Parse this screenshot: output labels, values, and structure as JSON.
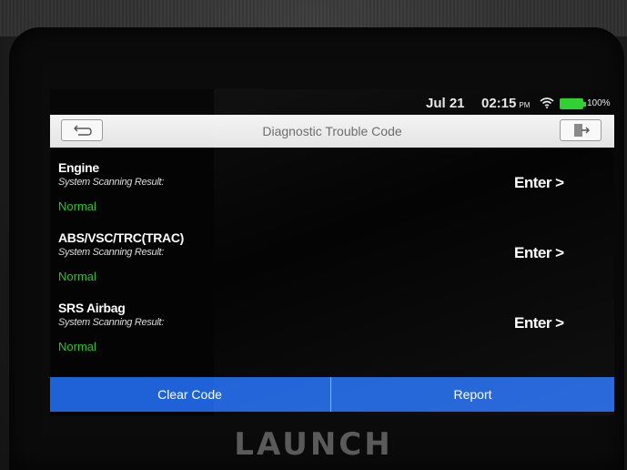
{
  "status_bar": {
    "date": "Jul 21",
    "time": "02:15",
    "ampm": "PM",
    "battery": "100%",
    "battery_color": "#2ed12e"
  },
  "title_bar": {
    "title": "Diagnostic Trouble Code",
    "back_icon": "back-arrow-icon",
    "exit_icon": "exit-icon"
  },
  "systems": [
    {
      "name": "Engine",
      "result_label": "System Scanning Result:",
      "status": "Normal",
      "enter_label": "Enter >"
    },
    {
      "name": "ABS/VSC/TRC(TRAC)",
      "result_label": "System Scanning Result:",
      "status": "Normal",
      "enter_label": "Enter >"
    },
    {
      "name": "SRS Airbag",
      "result_label": "System Scanning Result:",
      "status": "Normal",
      "enter_label": "Enter >"
    }
  ],
  "buttons": {
    "clear_code": "Clear Code",
    "report": "Report",
    "accent_color": "#1f62d8"
  },
  "brand": "LAUNCH",
  "status_color": "#29c829"
}
